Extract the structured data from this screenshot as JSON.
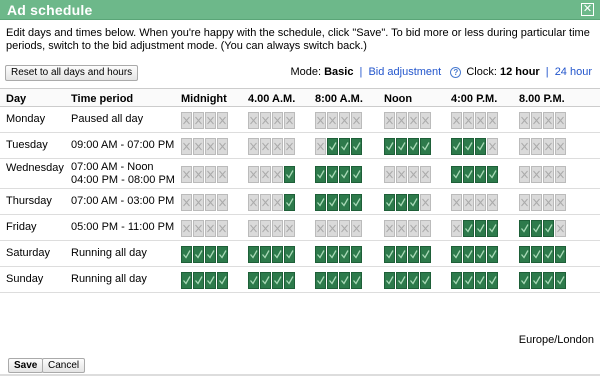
{
  "dialog": {
    "title": "Ad schedule",
    "close_label": "✕",
    "intro": "Edit days and times below. When you're happy with the schedule, click \"Save\". To bid more or less during particular time periods, switch to the bid adjustment mode. (You can always switch back.)"
  },
  "toolbar": {
    "reset_label": "Reset to all days and hours",
    "mode_prefix": "Mode:",
    "mode_basic": "Basic",
    "mode_separator": "|",
    "mode_bid_adjustment": "Bid adjustment",
    "help_icon": "question-icon",
    "clock_prefix": "Clock:",
    "clock_12": "12 hour",
    "clock_separator": "|",
    "clock_24": "24 hour"
  },
  "grid": {
    "col_day": "Day",
    "col_period": "Time period",
    "time_headers": [
      "Midnight",
      "4.00 A.M.",
      "8:00 A.M.",
      "Noon",
      "4:00 P.M.",
      "8.00 P.M."
    ],
    "rows": [
      {
        "day": "Monday",
        "period": "Paused all day",
        "hours": "000000000000000000000000"
      },
      {
        "day": "Tuesday",
        "period": "09:00 AM - 07:00 PM",
        "hours": "000000000111111111100000"
      },
      {
        "day": "Wednesday",
        "period": "07:00 AM - Noon\n04:00 PM - 08:00 PM",
        "hours": "000000011111000011110000"
      },
      {
        "day": "Thursday",
        "period": "07:00 AM - 03:00 PM",
        "hours": "000000011111111000000000"
      },
      {
        "day": "Friday",
        "period": "05:00 PM - 11:00 PM",
        "hours": "000000000000000001111110"
      },
      {
        "day": "Saturday",
        "period": "Running all day",
        "hours": "111111111111111111111111"
      },
      {
        "day": "Sunday",
        "period": "Running all day",
        "hours": "111111111111111111111111"
      }
    ]
  },
  "footer": {
    "timezone": "Europe/London",
    "save_label": "Save",
    "cancel_label": "Cancel"
  },
  "colors": {
    "titlebar": "#6db88a",
    "active_cell": "#2d7a4b",
    "inactive_cell": "#dadada",
    "link": "#2255cc"
  }
}
